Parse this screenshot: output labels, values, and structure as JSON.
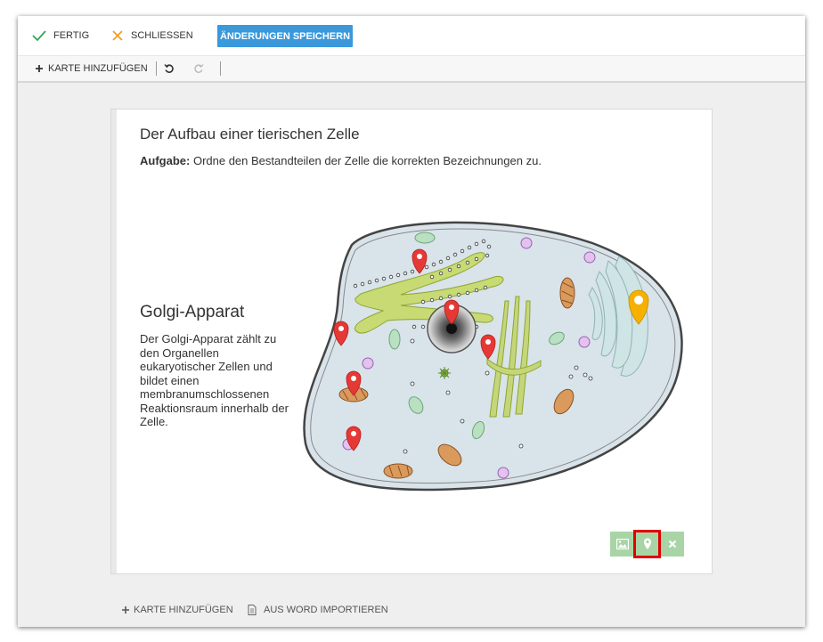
{
  "topbar": {
    "done_label": "FERTIG",
    "close_label": "SCHLIESSEN",
    "save_label": "ÄNDERUNGEN SPEICHERN",
    "check_color": "#2fa84f",
    "close_color": "#f0a020",
    "save_color": "#3a98db"
  },
  "toolbar": {
    "add_card_label": "KARTE HINZUFÜGEN"
  },
  "card": {
    "title": "Der Aufbau einer tierischen Zelle",
    "task_label": "Aufgabe:",
    "task_text": " Ordne den Bestandteilen der Zelle die korrekten Bezeichnungen zu.",
    "info_title": "Golgi-Apparat",
    "info_text": "Der Golgi-Apparat zählt zu den Organellen eukaryotischer Zellen und bildet einen membranumschlossenen Reaktionsraum innerhalb der Zelle.",
    "pin_color": "#e53935",
    "selected_pin_color": "#f6b000",
    "controls": [
      "image-icon",
      "pin-icon",
      "close-icon"
    ]
  },
  "bottombar": {
    "add_card_label": "KARTE HINZUFÜGEN",
    "import_label": "AUS WORD IMPORTIEREN"
  }
}
